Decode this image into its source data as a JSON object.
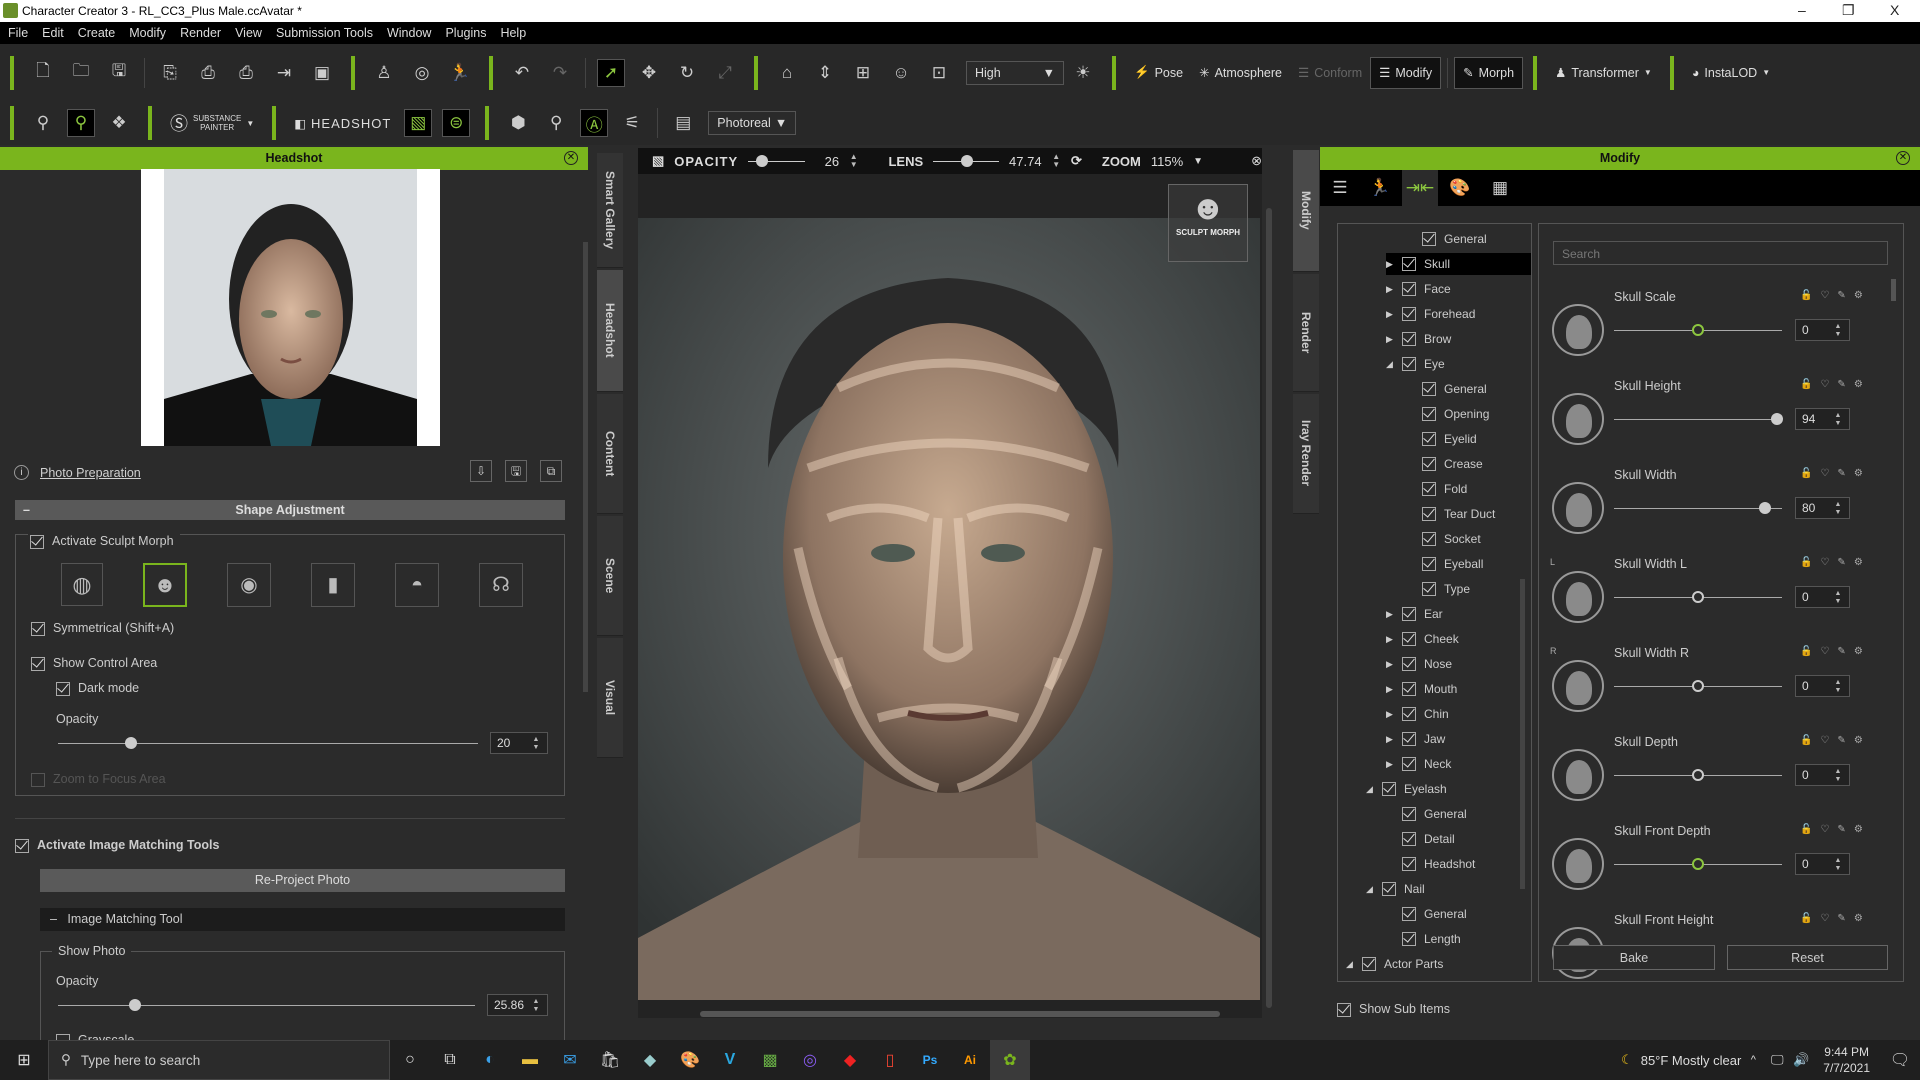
{
  "window": {
    "title": "Character Creator 3 - RL_CC3_Plus Male.ccAvatar *",
    "minimize": "–",
    "maximize": "❐",
    "close": "X"
  },
  "menu": [
    "File",
    "Edit",
    "Create",
    "Modify",
    "Render",
    "View",
    "Submission Tools",
    "Window",
    "Plugins",
    "Help"
  ],
  "toolbar1": {
    "quality": "High",
    "pose": "Pose",
    "atmosphere": "Atmosphere",
    "conform": "Conform",
    "modify": "Modify",
    "morph": "Morph",
    "transformer": "Transformer",
    "instalod": "InstaLOD"
  },
  "toolbar2": {
    "substance_line1": "SUBSTANCE",
    "substance_line2": "PAINTER",
    "headshot": "HEADSHOT",
    "render_mode": "Photoreal"
  },
  "accent": "#7ab51d",
  "headshot_panel": {
    "title": "Headshot",
    "photo_preparation": "Photo Preparation",
    "shape_adjustment": "Shape Adjustment",
    "activate_sculpt_morph": "Activate Sculpt Morph",
    "sculpt_icons": [
      "skull",
      "face",
      "eye",
      "nose",
      "mouth",
      "ear"
    ],
    "symmetrical": "Symmetrical (Shift+A)",
    "show_control_area": "Show Control Area",
    "dark_mode": "Dark mode",
    "opacity_label": "Opacity",
    "opacity_value": "20",
    "zoom_to_focus": "Zoom to Focus Area",
    "activate_image_matching": "Activate Image Matching Tools",
    "reproject": "Re-Project Photo",
    "image_matching_tool": "Image Matching Tool",
    "show_photo": "Show Photo",
    "photo_opacity_label": "Opacity",
    "photo_opacity_value": "25.86",
    "grayscale": "Grayscale"
  },
  "left_tabs": [
    "Smart Gallery",
    "Headshot",
    "Content",
    "Scene",
    "Visual"
  ],
  "right_tabs": [
    "Modify",
    "Render",
    "Iray Render"
  ],
  "viewport": {
    "opacity_label": "OPACITY",
    "opacity_value": "26",
    "lens_label": "LENS",
    "lens_value": "47.74",
    "zoom_label": "ZOOM",
    "zoom_value": "115%",
    "sculpt_morph": "SCULPT MORPH"
  },
  "modify_panel": {
    "title": "Modify",
    "search_placeholder": "Search",
    "tree": [
      {
        "label": "General",
        "level": 2,
        "arrow": ""
      },
      {
        "label": "Skull",
        "level": 1,
        "arrow": "▶",
        "selected": true
      },
      {
        "label": "Face",
        "level": 1,
        "arrow": "▶"
      },
      {
        "label": "Forehead",
        "level": 1,
        "arrow": "▶"
      },
      {
        "label": "Brow",
        "level": 1,
        "arrow": "▶"
      },
      {
        "label": "Eye",
        "level": 1,
        "arrow": "◢"
      },
      {
        "label": "General",
        "level": 2,
        "arrow": ""
      },
      {
        "label": "Opening",
        "level": 2,
        "arrow": ""
      },
      {
        "label": "Eyelid",
        "level": 2,
        "arrow": ""
      },
      {
        "label": "Crease",
        "level": 2,
        "arrow": ""
      },
      {
        "label": "Fold",
        "level": 2,
        "arrow": ""
      },
      {
        "label": "Tear Duct",
        "level": 2,
        "arrow": ""
      },
      {
        "label": "Socket",
        "level": 2,
        "arrow": ""
      },
      {
        "label": "Eyeball",
        "level": 2,
        "arrow": ""
      },
      {
        "label": "Type",
        "level": 2,
        "arrow": ""
      },
      {
        "label": "Ear",
        "level": 1,
        "arrow": "▶"
      },
      {
        "label": "Cheek",
        "level": 1,
        "arrow": "▶"
      },
      {
        "label": "Nose",
        "level": 1,
        "arrow": "▶"
      },
      {
        "label": "Mouth",
        "level": 1,
        "arrow": "▶"
      },
      {
        "label": "Chin",
        "level": 1,
        "arrow": "▶"
      },
      {
        "label": "Jaw",
        "level": 1,
        "arrow": "▶"
      },
      {
        "label": "Neck",
        "level": 1,
        "arrow": "▶"
      },
      {
        "label": "Eyelash",
        "level": 0,
        "arrow": "◢"
      },
      {
        "label": "General",
        "level": 1,
        "arrow": ""
      },
      {
        "label": "Detail",
        "level": 1,
        "arrow": ""
      },
      {
        "label": "Headshot",
        "level": 1,
        "arrow": ""
      },
      {
        "label": "Nail",
        "level": 0,
        "arrow": "◢"
      },
      {
        "label": "General",
        "level": 1,
        "arrow": ""
      },
      {
        "label": "Length",
        "level": 1,
        "arrow": ""
      },
      {
        "label": "Actor Parts",
        "level": -1,
        "arrow": "◢"
      }
    ],
    "params": [
      {
        "name": "Skull Scale",
        "value": "0",
        "active": true
      },
      {
        "name": "Skull Height",
        "value": "94"
      },
      {
        "name": "Skull Width",
        "value": "80"
      },
      {
        "name": "Skull Width L",
        "value": "0",
        "side": "L"
      },
      {
        "name": "Skull Width R",
        "value": "0",
        "side": "R"
      },
      {
        "name": "Skull Depth",
        "value": "0"
      },
      {
        "name": "Skull Front Depth",
        "value": "0",
        "active": true
      },
      {
        "name": "Skull Front Height"
      }
    ],
    "slider_range": [
      -100,
      100
    ],
    "bake": "Bake",
    "reset": "Reset",
    "show_sub_items": "Show Sub Items"
  },
  "taskbar": {
    "search_placeholder": "Type here to search",
    "weather": "85°F  Mostly clear",
    "time": "9:44 PM",
    "date": "7/7/2021"
  }
}
